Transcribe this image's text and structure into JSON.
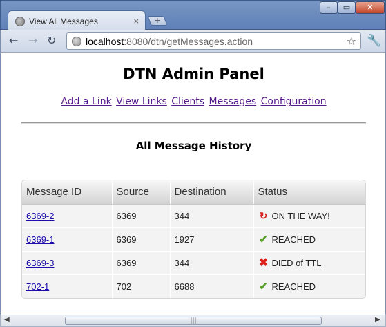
{
  "browser": {
    "tab_title": "View All Messages",
    "tab_close": "×",
    "new_tab": "+",
    "win_min": "–",
    "win_max": "▭",
    "win_close": "✕",
    "nav_back": "←",
    "nav_forward": "→",
    "nav_reload": "↻",
    "url_host": "localhost",
    "url_rest": ":8080/dtn/getMessages.action",
    "star": "☆",
    "wrench": "🔧"
  },
  "page": {
    "title": "DTN Admin Panel",
    "nav": [
      {
        "label": "Add a Link"
      },
      {
        "label": "View Links"
      },
      {
        "label": "Clients"
      },
      {
        "label": "Messages"
      },
      {
        "label": "Configuration"
      }
    ],
    "section_title": "All Message History"
  },
  "table": {
    "headers": [
      "Message ID",
      "Source",
      "Destination",
      "Status"
    ],
    "rows": [
      {
        "id": "6369-2",
        "source": "6369",
        "destination": "344",
        "status": "ON THE WAY!",
        "icon": "↻",
        "icon_name": "refresh-icon"
      },
      {
        "id": "6369-1",
        "source": "6369",
        "destination": "1927",
        "status": "REACHED",
        "icon": "✔",
        "icon_name": "check-icon"
      },
      {
        "id": "6369-3",
        "source": "6369",
        "destination": "344",
        "status": "DIED of TTL",
        "icon": "✖",
        "icon_name": "cross-icon"
      },
      {
        "id": "702-1",
        "source": "702",
        "destination": "6688",
        "status": "REACHED",
        "icon": "✔",
        "icon_name": "check-icon"
      }
    ]
  },
  "scrollbar": {
    "left": "◀",
    "right": "▶",
    "grip": "|||"
  },
  "colors": {
    "link": "#551a8b",
    "reached": "#5aa02c",
    "error": "#e0201a"
  }
}
